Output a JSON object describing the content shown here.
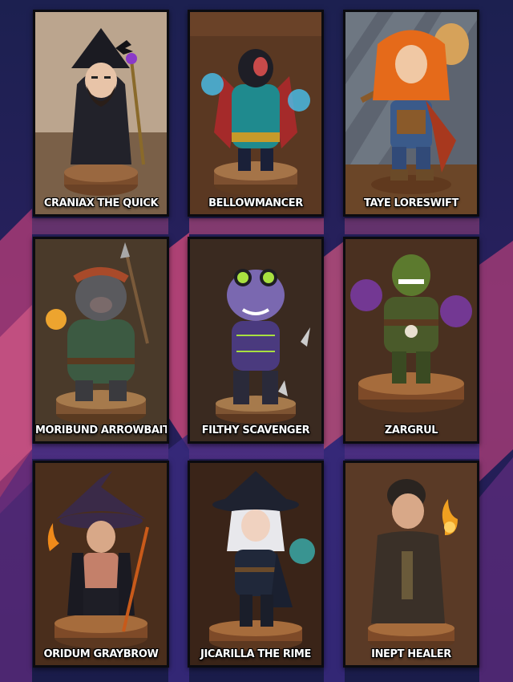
{
  "cards": [
    {
      "name": "CRANIAX THE QUICK",
      "figure": "dark-wizard-with-crow-and-staff"
    },
    {
      "name": "BELLOWMANCER",
      "figure": "bear-mage-with-blue-lightning"
    },
    {
      "name": "TAYE LORESWIFT",
      "figure": "red-haired-bard-with-guitar"
    },
    {
      "name": "MORIBUND ARROWBAIT",
      "figure": "boar-warrior-with-spear"
    },
    {
      "name": "FILTHY SCAVENGER",
      "figure": "purple-goblin-with-goggles"
    },
    {
      "name": "ZARGRUL",
      "figure": "orc-with-purple-magic"
    },
    {
      "name": "ORIDUM GRAYBROW",
      "figure": "witch-hat-fire-mage"
    },
    {
      "name": "JICARILLA THE RIME",
      "figure": "white-haired-frost-witch"
    },
    {
      "name": "INEPT HEALER",
      "figure": "robed-healer-with-flame"
    }
  ]
}
